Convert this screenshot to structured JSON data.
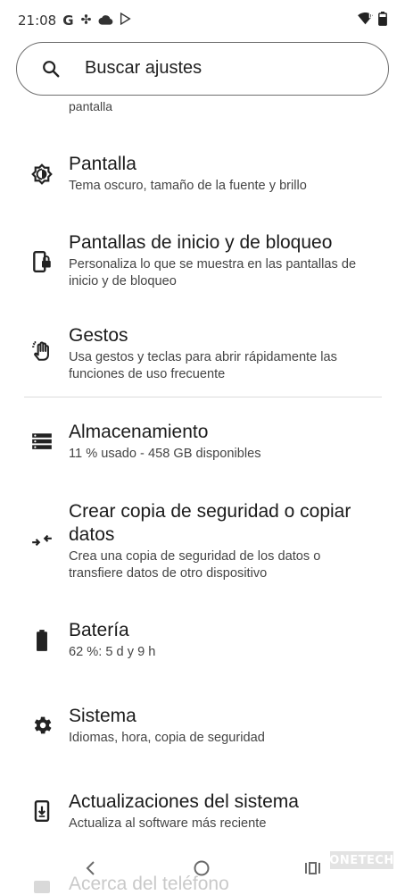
{
  "status_bar": {
    "time": "21:08",
    "g_label": "G",
    "left_icons": [
      "google-icon",
      "fan-icon",
      "cloud-icon",
      "play-store-icon"
    ],
    "right_icons": [
      "wifi-icon",
      "battery-icon"
    ]
  },
  "search": {
    "placeholder": "Buscar ajustes"
  },
  "partial_above": "pantalla",
  "items": [
    {
      "title": "Pantalla",
      "summary": "Tema oscuro, tamaño de la fuente y brillo",
      "icon": "display-brightness-icon"
    },
    {
      "title": "Pantallas de inicio y de bloqueo",
      "summary": "Personaliza lo que se muestra en las pantallas de inicio y de bloqueo",
      "icon": "lock-screen-icon"
    },
    {
      "title": "Gestos",
      "summary": "Usa gestos y teclas para abrir rápidamente las funciones de uso frecuente",
      "icon": "gesture-hand-icon"
    },
    {
      "title": "Almacenamiento",
      "summary": "11 % usado - 458 GB disponibles",
      "icon": "storage-icon"
    },
    {
      "title": "Crear copia de seguridad o copiar datos",
      "summary": "Crea una copia de seguridad de los datos o transfiere datos de otro dispositivo",
      "icon": "backup-transfer-icon"
    },
    {
      "title": "Batería",
      "summary": "62 %: 5 d y 9 h",
      "icon": "battery-icon"
    },
    {
      "title": "Sistema",
      "summary": "Idiomas, hora, copia de seguridad",
      "icon": "gear-icon"
    },
    {
      "title": "Actualizaciones del sistema",
      "summary": "Actualiza al software más reciente",
      "icon": "system-update-icon"
    }
  ],
  "partial_below": "Acerca del teléfono",
  "nav": {
    "back": "back-icon",
    "home": "home-icon",
    "recents": "recents-icon"
  },
  "watermark": "ONETECH"
}
